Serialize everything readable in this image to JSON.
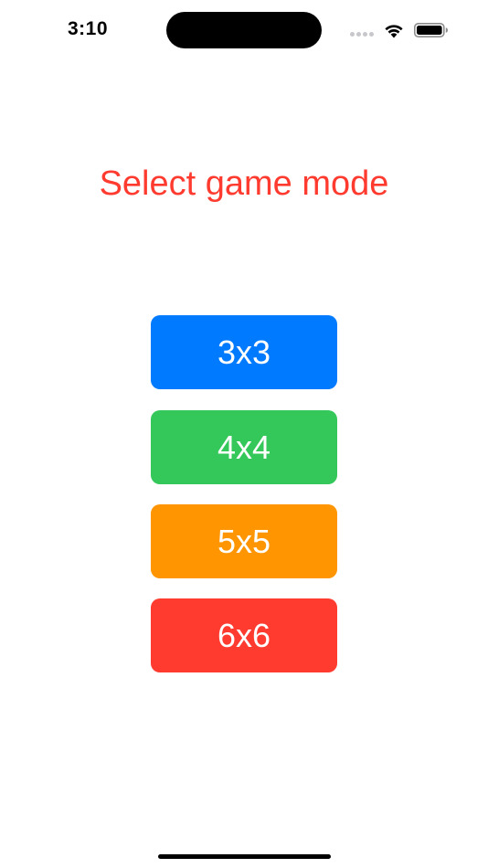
{
  "status_bar": {
    "time": "3:10",
    "icons": [
      "signal-icon",
      "wifi-icon",
      "battery-icon"
    ]
  },
  "title": "Select game mode",
  "title_color": "#ff3b30",
  "modes": [
    {
      "label": "3x3",
      "color": "#007aff"
    },
    {
      "label": "4x4",
      "color": "#34c759"
    },
    {
      "label": "5x5",
      "color": "#ff9500"
    },
    {
      "label": "6x6",
      "color": "#ff3b30"
    }
  ]
}
